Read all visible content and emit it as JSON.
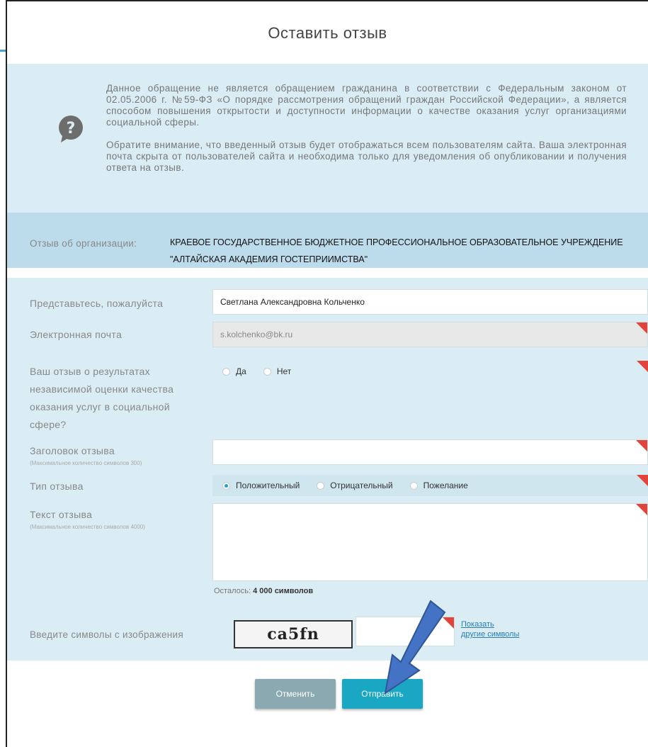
{
  "dialog": {
    "title": "Оставить отзыв"
  },
  "info": {
    "paragraph1": "Данное обращение не является обращением гражданина в соответствии с Федеральным законом от 02.05.2006 г. №59-ФЗ «О порядке рассмотрения обращений граждан Российской Федерации», а является способом повышения открытости и доступности информации о качестве оказания услуг организациями социальной сферы.",
    "paragraph2": "Обратите внимание, что введенный отзыв будет отображаться всем пользователям сайта. Ваша электронная почта скрыта от пользователей сайта и необходима только для уведомления об опубликовании и получения ответа на отзыв."
  },
  "organization": {
    "label": "Отзыв об организации:",
    "name": "КРАЕВОЕ ГОСУДАРСТВЕННОЕ БЮДЖЕТНОЕ ПРОФЕССИОНАЛЬНОЕ ОБРАЗОВАТЕЛЬНОЕ УЧРЕЖДЕНИЕ \"АЛТАЙСКАЯ АКАДЕМИЯ ГОСТЕПРИИМСТВА\""
  },
  "form": {
    "name_label": "Представьтесь, пожалуйста",
    "name_value": "Светлана Александровна Кольченко",
    "email_label": "Электронная почта",
    "email_value": "s.kolchenko@bk.ru",
    "nok_label": "Ваш отзыв о результатах независимой оценки качества оказания услуг в социальной сфере?",
    "nok_options": [
      "Да",
      "Нет"
    ],
    "subject_label": "Заголовок отзыва",
    "subject_hint": "(Максимальное количество символов 300)",
    "subject_value": "",
    "type_label": "Тип отзыва",
    "type_options": [
      "Положительный",
      "Отрицательный",
      "Пожелание"
    ],
    "type_selected": "Положительный",
    "text_label": "Текст отзыва",
    "text_hint": "(Максимальное количество символов 4000)",
    "remaining_prefix": "Осталось:",
    "remaining_count": "4 000 символов"
  },
  "captcha": {
    "label": "Введите символы с изображения",
    "image_text": "ca5fn",
    "link_line1": "Показать",
    "link_line2": "другие символы"
  },
  "buttons": {
    "cancel": "Отменить",
    "send": "Отправить"
  },
  "colors": {
    "accent": "#1aa7c4",
    "required_marker": "#e0443b",
    "arrow": "#4472c4"
  }
}
